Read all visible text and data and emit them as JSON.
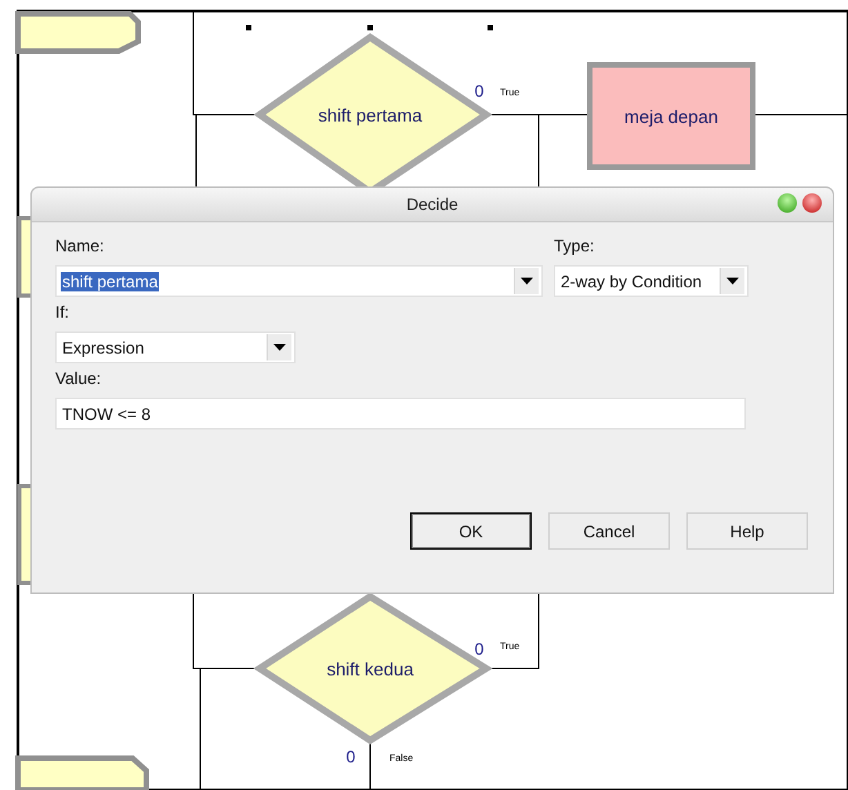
{
  "diagram": {
    "decides": [
      {
        "label": "shift pertama",
        "true_count": "0",
        "true_label": "True"
      },
      {
        "label": "shift kedua",
        "true_count": "0",
        "true_label": "True",
        "false_count": "0",
        "false_label": "False"
      }
    ],
    "process": {
      "label": "meja depan"
    }
  },
  "dialog": {
    "title": "Decide",
    "name": {
      "label": "Name:",
      "value": "shift pertama",
      "highlighted": true
    },
    "type": {
      "label": "Type:",
      "value": "2-way by Condition"
    },
    "if": {
      "label": "If:",
      "value": "Expression"
    },
    "value": {
      "label": "Value:",
      "value": "TNOW <= 8"
    },
    "buttons": [
      {
        "label": "OK",
        "default": true
      },
      {
        "label": "Cancel",
        "default": false
      },
      {
        "label": "Help",
        "default": false
      }
    ]
  }
}
